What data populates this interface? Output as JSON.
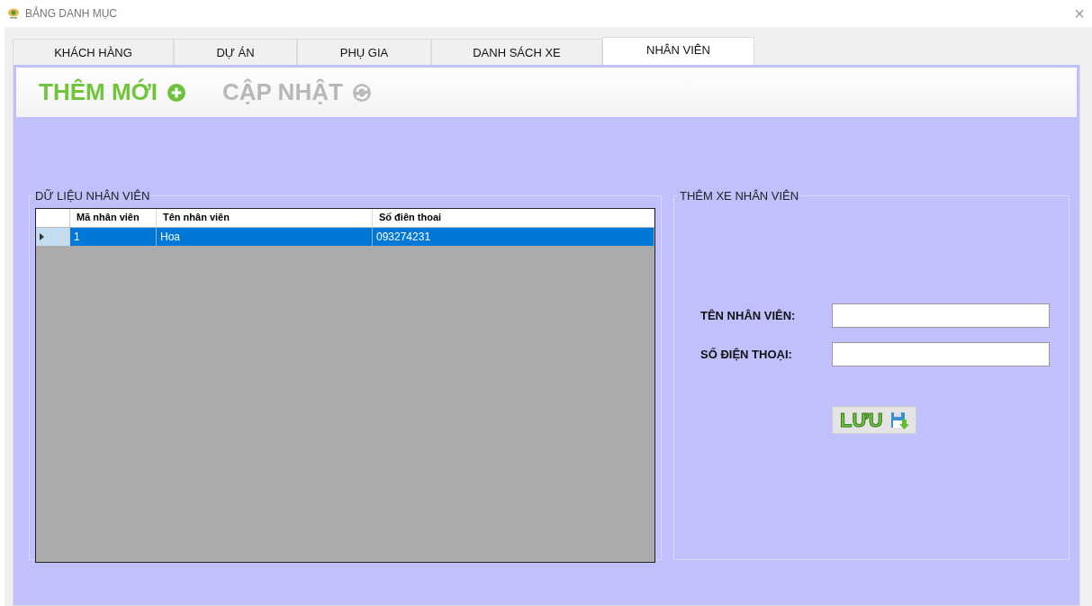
{
  "window": {
    "title": "BẢNG DANH MỤC",
    "close": "×"
  },
  "tabs": [
    {
      "label": "KHÁCH HÀNG",
      "selected": false
    },
    {
      "label": "DỰ ÁN",
      "selected": false
    },
    {
      "label": "PHỤ GIA",
      "selected": false
    },
    {
      "label": "DANH SÁCH XE",
      "selected": false
    },
    {
      "label": "NHÂN VIÊN",
      "selected": true
    }
  ],
  "toolbar": [
    {
      "label": "THÊM MỚI",
      "kind": "add",
      "disabled": false
    },
    {
      "label": "CẬP NHẬT",
      "kind": "refresh",
      "disabled": true
    }
  ],
  "data_group": {
    "title": "DỮ LIỆU NHÂN VIÊN",
    "columns": [
      "Mã nhân viên",
      "Tên nhân viên",
      "Số điên thoai"
    ],
    "rows": [
      {
        "cells": [
          "1",
          "Hoa",
          "093274231"
        ],
        "selected": true
      }
    ]
  },
  "form_group": {
    "title": "THÊM XE NHÂN VIÊN",
    "fields": [
      {
        "label": "TÊN NHÂN VIÊN:"
      },
      {
        "label": "SỐ ĐIỆN THOẠI:"
      }
    ],
    "save_button": "LƯU"
  }
}
